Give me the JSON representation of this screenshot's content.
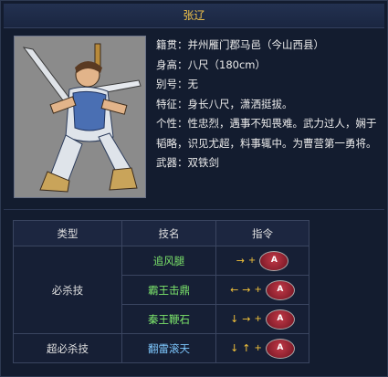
{
  "title": "张辽",
  "info": {
    "origin": "籍贯：并州雁门郡马邑（今山西县）",
    "height": "身高：八尺（180cm）",
    "alias": "别号：无",
    "feature": "特征：身长八尺，潇洒挺拔。",
    "personality": "个性：性忠烈，遇事不知畏难。武力过人，娴于韬略，识见尤超，料事辄中。为曹营第一勇将。",
    "weapon": "武器：双铁剑"
  },
  "table": {
    "headers": [
      "类型",
      "技名",
      "指令"
    ],
    "rows": [
      {
        "type": "必杀技",
        "name": "追风腿",
        "command": [
          "→",
          "+",
          "A"
        ]
      },
      {
        "name": "霸王击鼎",
        "command": [
          "←",
          "→",
          "+",
          "A"
        ]
      },
      {
        "name": "秦王鞭石",
        "command": [
          "↓",
          "→",
          "+",
          "A"
        ]
      },
      {
        "type": "超必杀技",
        "name": "翻雷滚天",
        "command": [
          "↓",
          "↑",
          "+",
          "A"
        ]
      }
    ]
  },
  "colors": {
    "title": "#f1c24a",
    "skill_name": "#7be36a",
    "super_skill_name": "#7ec8ff",
    "arrow": "#f2c23a",
    "button": "#c23a48"
  },
  "icons": {
    "button": "a-button-icon",
    "arrow_right": "arrow-right-icon",
    "arrow_left": "arrow-left-icon",
    "arrow_down": "arrow-down-icon",
    "arrow_up": "arrow-up-icon"
  }
}
